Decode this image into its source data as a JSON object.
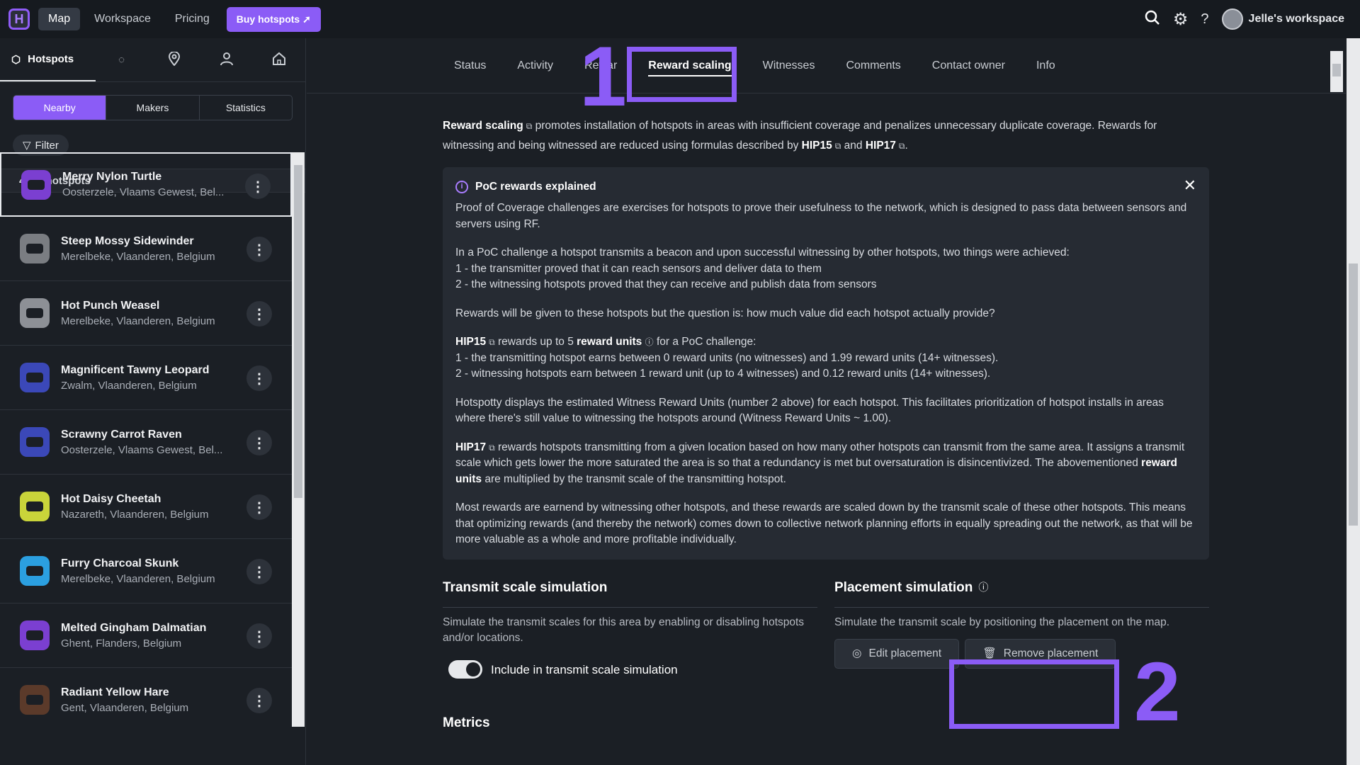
{
  "topbar": {
    "logo": "H",
    "nav": [
      "Map",
      "Workspace",
      "Pricing"
    ],
    "buy_label": "Buy hotspots",
    "workspace_label": "Jelle's workspace"
  },
  "sidebar": {
    "tab_label": "Hotspots",
    "segments": [
      "Nearby",
      "Makers",
      "Statistics"
    ],
    "filter_label": "Filter",
    "count_label": "4490 hotspots",
    "items": [
      {
        "name": "Merry Nylon Turtle",
        "location": "Oosterzele, Vlaams Gewest, Bel...",
        "color": "#7b3fd1"
      },
      {
        "name": "Steep Mossy Sidewinder",
        "location": "Merelbeke, Vlaanderen, Belgium",
        "color": "#7a7d82"
      },
      {
        "name": "Hot Punch Weasel",
        "location": "Merelbeke, Vlaanderen, Belgium",
        "color": "#8d9096"
      },
      {
        "name": "Magnificent Tawny Leopard",
        "location": "Zwalm, Vlaanderen, Belgium",
        "color": "#3b48b8"
      },
      {
        "name": "Scrawny Carrot Raven",
        "location": "Oosterzele, Vlaams Gewest, Bel...",
        "color": "#3b48b8"
      },
      {
        "name": "Hot Daisy Cheetah",
        "location": "Nazareth, Vlaanderen, Belgium",
        "color": "#c9d43a"
      },
      {
        "name": "Furry Charcoal Skunk",
        "location": "Merelbeke, Vlaanderen, Belgium",
        "color": "#2b9fe0"
      },
      {
        "name": "Melted Gingham Dalmatian",
        "location": "Ghent, Flanders, Belgium",
        "color": "#7b3fd1"
      },
      {
        "name": "Radiant Yellow Hare",
        "location": "Gent, Vlaanderen, Belgium",
        "color": "#5b3a2a"
      }
    ]
  },
  "tabs": [
    "Status",
    "Activity",
    "Rewar",
    "Reward scaling",
    "Witnesses",
    "Comments",
    "Contact owner",
    "Info"
  ],
  "annotations": {
    "one": "1",
    "two": "2"
  },
  "content": {
    "intro_link": "Reward scaling",
    "intro_text": "promotes installation of hotspots in areas with insufficient coverage and penalizes unnecessary duplicate coverage. Rewards for witnessing and being witnessed are reduced using formulas described by",
    "intro_hip15": "HIP15",
    "intro_and": "and",
    "intro_hip17": "HIP17",
    "intro_end": ".",
    "box_title": "PoC rewards explained",
    "p1": "Proof of Coverage challenges are exercises for hotspots to prove their usefulness to the network, which is designed to pass data between sensors and servers using RF.",
    "p2a": "In a PoC challenge a hotspot transmits a beacon and upon successful witnessing by other hotspots, two things were achieved:",
    "p2b": "1 - the transmitter proved that it can reach sensors and deliver data to them",
    "p2c": "2 - the witnessing hotspots proved that they can receive and publish data from sensors",
    "p3": "Rewards will be given to these hotspots but the question is: how much value did each hotspot actually provide?",
    "p4_hip": "HIP15",
    "p4_a": "rewards up to 5",
    "p4_units": "reward units",
    "p4_b": "for a PoC challenge:",
    "p4_l1": "1 - the transmitting hotspot earns between 0 reward units (no witnesses) and 1.99 reward units (14+ witnesses).",
    "p4_l2": "2 - witnessing hotspots earn between 1 reward unit (up to 4 witnesses) and 0.12 reward units (14+ witnesses).",
    "p5": "Hotspotty displays the estimated Witness Reward Units (number 2 above) for each hotspot. This facilitates prioritization of hotspot installs in areas where there's still value to witnessing the hotspots around (Witness Reward Units ~ 1.00).",
    "p6_hip": "HIP17",
    "p6_a": "rewards hotspots transmitting from a given location based on how many other hotspots can transmit from the same area. It assigns a transmit scale which gets lower the more saturated the area is so that a redundancy is met but oversaturation is disincentivized. The abovementioned",
    "p6_units": "reward units",
    "p6_b": "are multiplied by the transmit scale of the transmitting hotspot.",
    "p7": "Most rewards are earnend by witnessing other hotspots, and these rewards are scaled down by the transmit scale of these other hotspots. This means that optimizing rewards (and thereby the network) comes down to collective network planning efforts in equally spreading out the network, as that will be more valuable as a whole and more profitable individually."
  },
  "transmit": {
    "title": "Transmit scale simulation",
    "desc": "Simulate the transmit scales for this area by enabling or disabling hotspots and/or locations.",
    "toggle_label": "Include in transmit scale simulation"
  },
  "placement": {
    "title": "Placement simulation",
    "desc": "Simulate the transmit scale by positioning the placement on the map.",
    "edit_label": "Edit placement",
    "remove_label": "Remove placement"
  },
  "metrics_title": "Metrics"
}
